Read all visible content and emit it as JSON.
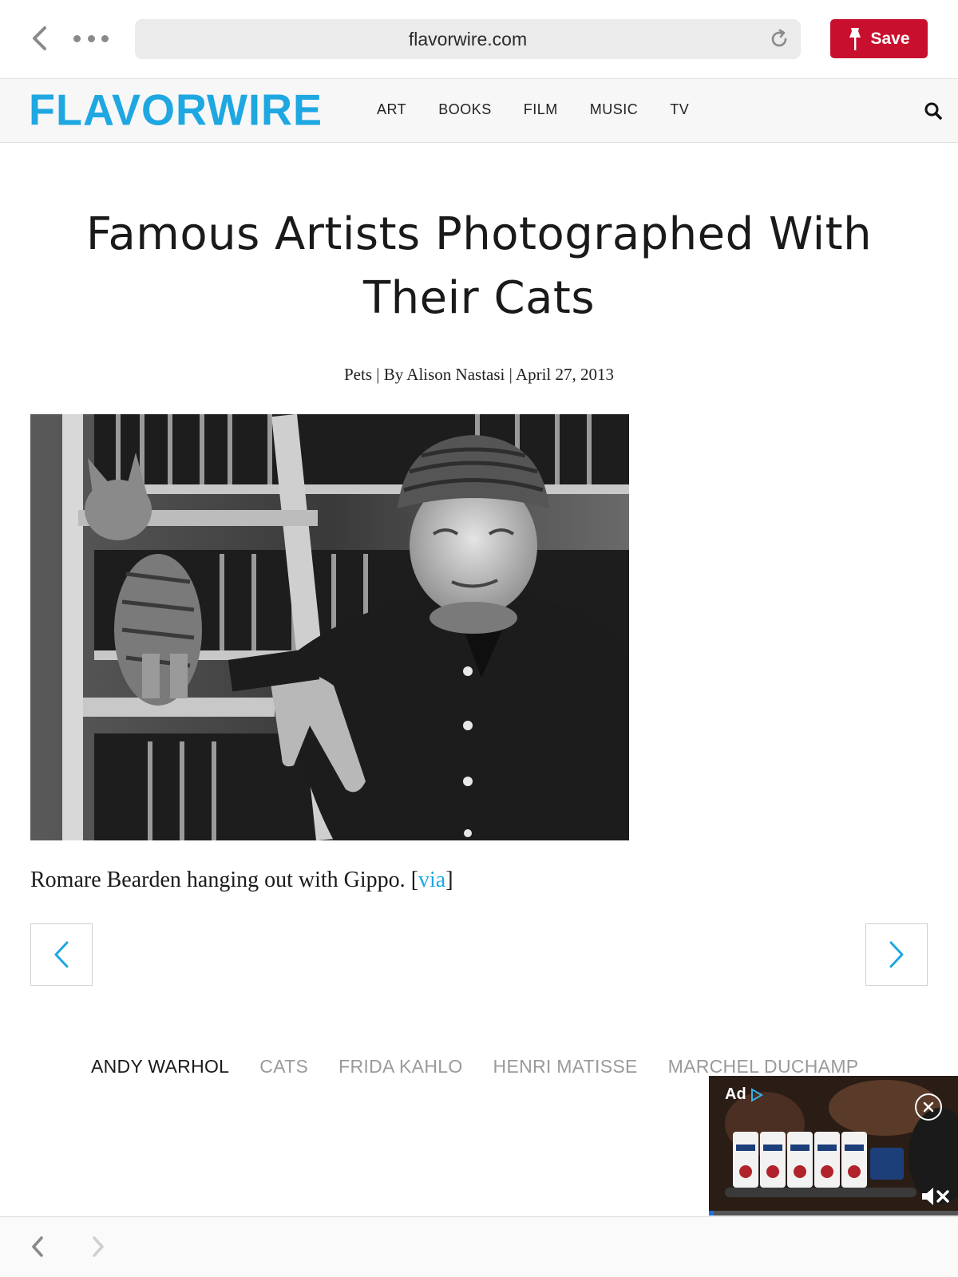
{
  "browser": {
    "url": "flavorwire.com",
    "save_label": "Save"
  },
  "site": {
    "logo": "FLAVORWIRE",
    "nav": [
      "ART",
      "BOOKS",
      "FILM",
      "MUSIC",
      "TV"
    ]
  },
  "article": {
    "title": "Famous Artists Photographed With Their Cats",
    "byline": "Pets | By Alison Nastasi | April 27, 2013",
    "caption_text": "Romare Bearden hanging out with Gippo. ",
    "caption_bracket_open": "[",
    "caption_link": "via",
    "caption_bracket_close": "]"
  },
  "tags": [
    "ANDY WARHOL",
    "CATS",
    "FRIDA KAHLO",
    "HENRI MATISSE",
    "MARCHEL DUCHAMP"
  ],
  "ad": {
    "label": "Ad",
    "progress": 0.02
  },
  "colors": {
    "brand": "#1ea7e1",
    "save": "#c8102e"
  }
}
